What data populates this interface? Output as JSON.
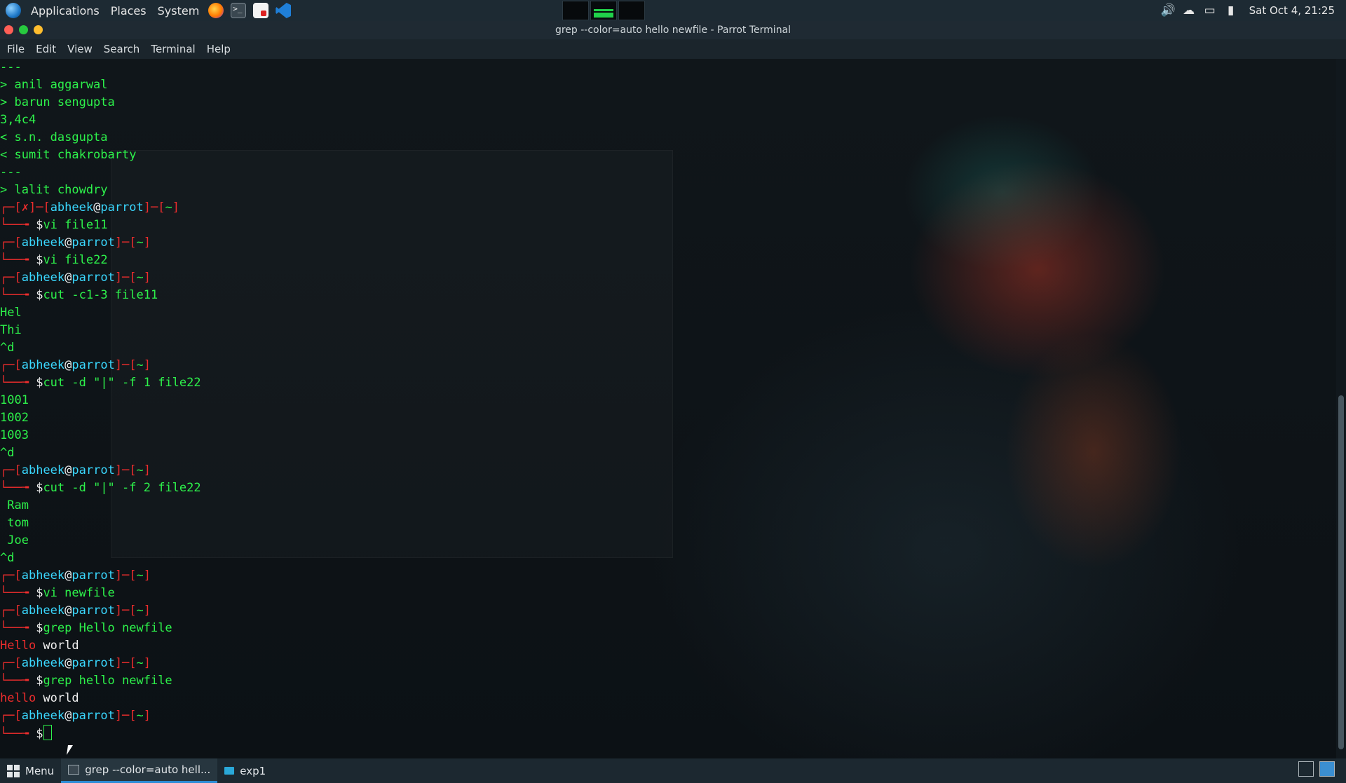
{
  "top_panel": {
    "menus": [
      "Applications",
      "Places",
      "System"
    ],
    "launchers": [
      "firefox-icon",
      "terminal-icon",
      "document-viewer-icon",
      "vscode-icon"
    ],
    "workspaces": 3,
    "clock": "Sat Oct  4, 21:25"
  },
  "window": {
    "title": "grep --color=auto hello newfile - Parrot Terminal",
    "menu": [
      "File",
      "Edit",
      "View",
      "Search",
      "Terminal",
      "Help"
    ]
  },
  "terminal": {
    "lines": [
      [
        [
          "g",
          "---"
        ]
      ],
      [
        [
          "g",
          "> anil aggarwal"
        ]
      ],
      [
        [
          "g",
          "> barun sengupta"
        ]
      ],
      [
        [
          "g",
          "3,4c4"
        ]
      ],
      [
        [
          "g",
          "< s.n. dasgupta"
        ]
      ],
      [
        [
          "g",
          "< sumit chakrobarty"
        ]
      ],
      [
        [
          "g",
          "---"
        ]
      ],
      [
        [
          "g",
          "> lalit chowdry"
        ]
      ],
      [
        [
          "r",
          "┌─["
        ],
        [
          "r",
          "✗"
        ],
        [
          "r",
          "]─["
        ],
        [
          "c",
          "abheek"
        ],
        [
          "w",
          "@"
        ],
        [
          "c",
          "parrot"
        ],
        [
          "r",
          "]─["
        ],
        [
          "g",
          "~"
        ],
        [
          "r",
          "]"
        ]
      ],
      [
        [
          "r",
          "└──╼ "
        ],
        [
          "w",
          "$"
        ],
        [
          "g",
          "vi file11"
        ]
      ],
      [
        [
          "r",
          "┌─["
        ],
        [
          "c",
          "abheek"
        ],
        [
          "w",
          "@"
        ],
        [
          "c",
          "parrot"
        ],
        [
          "r",
          "]─["
        ],
        [
          "g",
          "~"
        ],
        [
          "r",
          "]"
        ]
      ],
      [
        [
          "r",
          "└──╼ "
        ],
        [
          "w",
          "$"
        ],
        [
          "g",
          "vi file22"
        ]
      ],
      [
        [
          "r",
          "┌─["
        ],
        [
          "c",
          "abheek"
        ],
        [
          "w",
          "@"
        ],
        [
          "c",
          "parrot"
        ],
        [
          "r",
          "]─["
        ],
        [
          "g",
          "~"
        ],
        [
          "r",
          "]"
        ]
      ],
      [
        [
          "r",
          "└──╼ "
        ],
        [
          "w",
          "$"
        ],
        [
          "g",
          "cut -c1-3 file11"
        ]
      ],
      [
        [
          "g",
          "Hel"
        ]
      ],
      [
        [
          "g",
          "Thi"
        ]
      ],
      [
        [
          "g",
          "^d"
        ]
      ],
      [
        [
          "r",
          "┌─["
        ],
        [
          "c",
          "abheek"
        ],
        [
          "w",
          "@"
        ],
        [
          "c",
          "parrot"
        ],
        [
          "r",
          "]─["
        ],
        [
          "g",
          "~"
        ],
        [
          "r",
          "]"
        ]
      ],
      [
        [
          "r",
          "└──╼ "
        ],
        [
          "w",
          "$"
        ],
        [
          "g",
          "cut -d \"|\" -f 1 file22"
        ]
      ],
      [
        [
          "g",
          "1001"
        ]
      ],
      [
        [
          "g",
          "1002"
        ]
      ],
      [
        [
          "g",
          "1003"
        ]
      ],
      [
        [
          "g",
          "^d"
        ]
      ],
      [
        [
          "r",
          "┌─["
        ],
        [
          "c",
          "abheek"
        ],
        [
          "w",
          "@"
        ],
        [
          "c",
          "parrot"
        ],
        [
          "r",
          "]─["
        ],
        [
          "g",
          "~"
        ],
        [
          "r",
          "]"
        ]
      ],
      [
        [
          "r",
          "└──╼ "
        ],
        [
          "w",
          "$"
        ],
        [
          "g",
          "cut -d \"|\" -f 2 file22"
        ]
      ],
      [
        [
          "g",
          " Ram"
        ]
      ],
      [
        [
          "g",
          " tom"
        ]
      ],
      [
        [
          "g",
          " Joe"
        ]
      ],
      [
        [
          "g",
          "^d"
        ]
      ],
      [
        [
          "r",
          "┌─["
        ],
        [
          "c",
          "abheek"
        ],
        [
          "w",
          "@"
        ],
        [
          "c",
          "parrot"
        ],
        [
          "r",
          "]─["
        ],
        [
          "g",
          "~"
        ],
        [
          "r",
          "]"
        ]
      ],
      [
        [
          "r",
          "└──╼ "
        ],
        [
          "w",
          "$"
        ],
        [
          "g",
          "vi newfile"
        ]
      ],
      [
        [
          "r",
          "┌─["
        ],
        [
          "c",
          "abheek"
        ],
        [
          "w",
          "@"
        ],
        [
          "c",
          "parrot"
        ],
        [
          "r",
          "]─["
        ],
        [
          "g",
          "~"
        ],
        [
          "r",
          "]"
        ]
      ],
      [
        [
          "r",
          "└──╼ "
        ],
        [
          "w",
          "$"
        ],
        [
          "g",
          "grep Hello newfile"
        ]
      ],
      [
        [
          "r",
          "Hello"
        ],
        [
          "w",
          " world"
        ]
      ],
      [
        [
          "r",
          "┌─["
        ],
        [
          "c",
          "abheek"
        ],
        [
          "w",
          "@"
        ],
        [
          "c",
          "parrot"
        ],
        [
          "r",
          "]─["
        ],
        [
          "g",
          "~"
        ],
        [
          "r",
          "]"
        ]
      ],
      [
        [
          "r",
          "└──╼ "
        ],
        [
          "w",
          "$"
        ],
        [
          "g",
          "grep hello newfile"
        ]
      ],
      [
        [
          "r",
          "hello"
        ],
        [
          "w",
          " world"
        ]
      ],
      [
        [
          "r",
          "┌─["
        ],
        [
          "c",
          "abheek"
        ],
        [
          "w",
          "@"
        ],
        [
          "c",
          "parrot"
        ],
        [
          "r",
          "]─["
        ],
        [
          "g",
          "~"
        ],
        [
          "r",
          "]"
        ]
      ],
      [
        [
          "r",
          "└──╼ "
        ],
        [
          "w",
          "$"
        ],
        [
          "cursor",
          ""
        ]
      ]
    ]
  },
  "taskbar": {
    "menu_label": "Menu",
    "tasks": [
      {
        "label": "grep --color=auto hell...",
        "icon": "terminal-icon",
        "active": true
      },
      {
        "label": "exp1",
        "icon": "folder-icon",
        "active": false
      }
    ]
  },
  "colors": {
    "prompt_bracket": "#ee2d2d",
    "prompt_user": "#3ad8ff",
    "output": "#2df24b",
    "accent": "#2c8cd6"
  }
}
